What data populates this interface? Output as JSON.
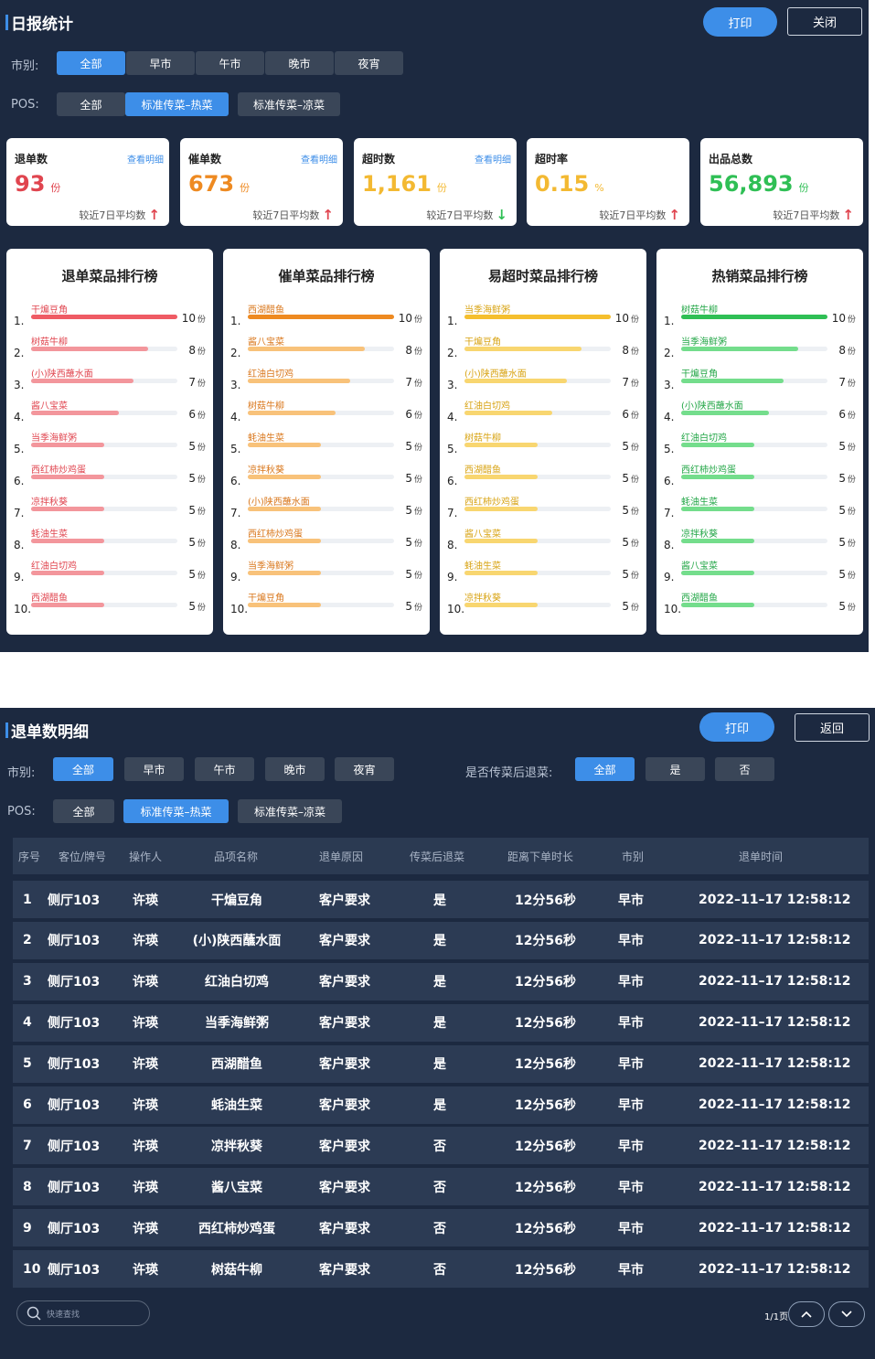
{
  "daily": {
    "title": "日报统计",
    "print": "打印",
    "close": "关闭",
    "market_label": "市别:",
    "markets": [
      "全部",
      "早市",
      "午市",
      "晚市",
      "夜宵"
    ],
    "pos_label": "POS:",
    "pos": [
      "全部",
      "标准传菜–热菜",
      "标准传菜–凉菜"
    ],
    "kpis": [
      {
        "title": "退单数",
        "link": "查看明细",
        "value": "93",
        "unit": "份",
        "compare": "较近7日平均数",
        "trend": "up",
        "color": "#e0454f"
      },
      {
        "title": "催单数",
        "link": "查看明细",
        "value": "673",
        "unit": "份",
        "compare": "较近7日平均数",
        "trend": "up",
        "color": "#ee8a21"
      },
      {
        "title": "超时数",
        "link": "查看明细",
        "value": "1,161",
        "unit": "份",
        "compare": "较近7日平均数",
        "trend": "down",
        "color": "#f3b932"
      },
      {
        "title": "超时率",
        "link": "",
        "value": "0.15",
        "unit": "%",
        "compare": "较近7日平均数",
        "trend": "up",
        "color": "#f3b932"
      },
      {
        "title": "出品总数",
        "link": "",
        "value": "56,893",
        "unit": "份",
        "compare": "较近7日平均数",
        "trend": "up",
        "color": "#2fbf55"
      }
    ],
    "rank_unit": "份",
    "rankings": [
      {
        "title": "退单菜品排行榜",
        "color": "#ef5b64",
        "light": "#f3969c",
        "text_color": "#e0454f",
        "items": [
          {
            "name": "干煸豆角",
            "value": 10
          },
          {
            "name": "树菇牛柳",
            "value": 8
          },
          {
            "name": "(小)陕西蘸水面",
            "value": 7
          },
          {
            "name": "酱八宝菜",
            "value": 6
          },
          {
            "name": "当季海鲜粥",
            "value": 5
          },
          {
            "name": "西红柿炒鸡蛋",
            "value": 5
          },
          {
            "name": "凉拌秋葵",
            "value": 5
          },
          {
            "name": "蚝油生菜",
            "value": 5
          },
          {
            "name": "红油白切鸡",
            "value": 5
          },
          {
            "name": "西湖醋鱼",
            "value": 5
          }
        ]
      },
      {
        "title": "催单菜品排行榜",
        "color": "#ee8a21",
        "light": "#f8c27a",
        "text_color": "#d9761a",
        "items": [
          {
            "name": "西湖醋鱼",
            "value": 10
          },
          {
            "name": "酱八宝菜",
            "value": 8
          },
          {
            "name": "红油白切鸡",
            "value": 7
          },
          {
            "name": "树菇牛柳",
            "value": 6
          },
          {
            "name": "蚝油生菜",
            "value": 5
          },
          {
            "name": "凉拌秋葵",
            "value": 5
          },
          {
            "name": "(小)陕西蘸水面",
            "value": 5
          },
          {
            "name": "西红柿炒鸡蛋",
            "value": 5
          },
          {
            "name": "当季海鲜粥",
            "value": 5
          },
          {
            "name": "干煸豆角",
            "value": 5
          }
        ]
      },
      {
        "title": "易超时菜品排行榜",
        "color": "#f5bf2e",
        "light": "#f8d670",
        "text_color": "#d8a312",
        "items": [
          {
            "name": "当季海鲜粥",
            "value": 10
          },
          {
            "name": "干煸豆角",
            "value": 8
          },
          {
            "name": "(小)陕西蘸水面",
            "value": 7
          },
          {
            "name": "红油白切鸡",
            "value": 6
          },
          {
            "name": "树菇牛柳",
            "value": 5
          },
          {
            "name": "西湖醋鱼",
            "value": 5
          },
          {
            "name": "西红柿炒鸡蛋",
            "value": 5
          },
          {
            "name": "酱八宝菜",
            "value": 5
          },
          {
            "name": "蚝油生菜",
            "value": 5
          },
          {
            "name": "凉拌秋葵",
            "value": 5
          }
        ]
      },
      {
        "title": "热销菜品排行榜",
        "color": "#2fbf55",
        "light": "#74dd8c",
        "text_color": "#22a646",
        "items": [
          {
            "name": "树菇牛柳",
            "value": 10
          },
          {
            "name": "当季海鲜粥",
            "value": 8
          },
          {
            "name": "干煸豆角",
            "value": 7
          },
          {
            "name": "(小)陕西蘸水面",
            "value": 6
          },
          {
            "name": "红油白切鸡",
            "value": 5
          },
          {
            "name": "西红柿炒鸡蛋",
            "value": 5
          },
          {
            "name": "蚝油生菜",
            "value": 5
          },
          {
            "name": "凉拌秋葵",
            "value": 5
          },
          {
            "name": "酱八宝菜",
            "value": 5
          },
          {
            "name": "西湖醋鱼",
            "value": 5
          }
        ]
      }
    ]
  },
  "detail": {
    "title": "退单数明细",
    "print": "打印",
    "back": "返回",
    "market_label": "市别:",
    "markets": [
      "全部",
      "早市",
      "午市",
      "晚市",
      "夜宵"
    ],
    "after_label": "是否传菜后退菜:",
    "after_options": [
      "全部",
      "是",
      "否"
    ],
    "pos_label": "POS:",
    "pos": [
      "全部",
      "标准传菜–热菜",
      "标准传菜–凉菜"
    ],
    "columns": [
      "序号",
      "客位/牌号",
      "操作人",
      "品项名称",
      "退单原因",
      "传菜后退菜",
      "距离下单时长",
      "市别",
      "退单时间"
    ],
    "rows": [
      [
        "1",
        "侧厅103",
        "许瑛",
        "干煸豆角",
        "客户要求",
        "是",
        "12分56秒",
        "早市",
        "2022–11–17 12:58:12"
      ],
      [
        "2",
        "侧厅103",
        "许瑛",
        "(小)陕西蘸水面",
        "客户要求",
        "是",
        "12分56秒",
        "早市",
        "2022–11–17 12:58:12"
      ],
      [
        "3",
        "侧厅103",
        "许瑛",
        "红油白切鸡",
        "客户要求",
        "是",
        "12分56秒",
        "早市",
        "2022–11–17 12:58:12"
      ],
      [
        "4",
        "侧厅103",
        "许瑛",
        "当季海鲜粥",
        "客户要求",
        "是",
        "12分56秒",
        "早市",
        "2022–11–17 12:58:12"
      ],
      [
        "5",
        "侧厅103",
        "许瑛",
        "西湖醋鱼",
        "客户要求",
        "是",
        "12分56秒",
        "早市",
        "2022–11–17 12:58:12"
      ],
      [
        "6",
        "侧厅103",
        "许瑛",
        "蚝油生菜",
        "客户要求",
        "是",
        "12分56秒",
        "早市",
        "2022–11–17 12:58:12"
      ],
      [
        "7",
        "侧厅103",
        "许瑛",
        "凉拌秋葵",
        "客户要求",
        "否",
        "12分56秒",
        "早市",
        "2022–11–17 12:58:12"
      ],
      [
        "8",
        "侧厅103",
        "许瑛",
        "酱八宝菜",
        "客户要求",
        "否",
        "12分56秒",
        "早市",
        "2022–11–17 12:58:12"
      ],
      [
        "9",
        "侧厅103",
        "许瑛",
        "西红柿炒鸡蛋",
        "客户要求",
        "否",
        "12分56秒",
        "早市",
        "2022–11–17 12:58:12"
      ],
      [
        "10",
        "侧厅103",
        "许瑛",
        "树菇牛柳",
        "客户要求",
        "否",
        "12分56秒",
        "早市",
        "2022–11–17 12:58:12"
      ]
    ],
    "search_placeholder": "快速查找",
    "page_info": "1/1页"
  }
}
